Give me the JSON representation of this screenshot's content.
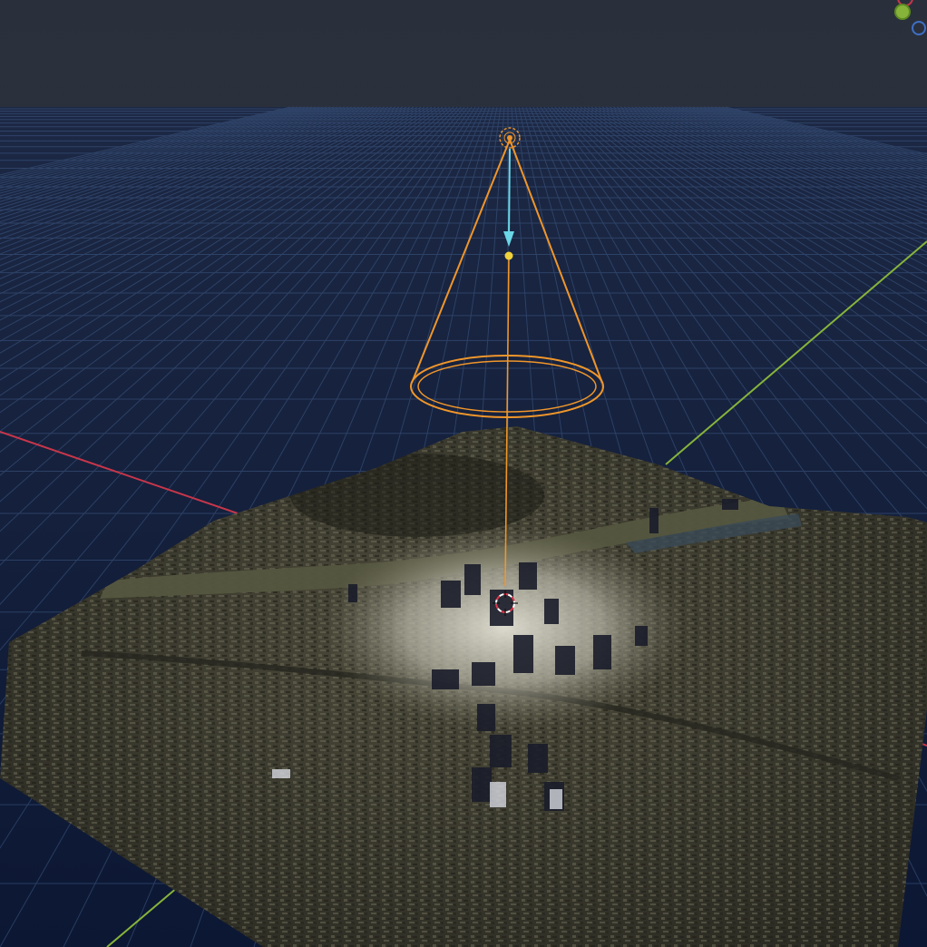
{
  "viewport": {
    "mode": "3d-perspective",
    "scene": "city-terrain",
    "grid": true,
    "colors": {
      "sky_top": "#2a303b",
      "sky_horizon": "#263244",
      "grid_floor": "#0f1a38",
      "grid_line": "#3f5a86",
      "x_axis": "#c8364a",
      "y_axis": "#86b43a",
      "terrain_dark": "#2b2a22",
      "terrain_mid": "#4a4838",
      "river": "#5b5c48",
      "spotlight_pool": "#d8d8cc",
      "light_gizmo": "#f0962a",
      "light_direction": "#6ad6e6",
      "light_target_point": "#f0d23a",
      "cursor_3d": "#e2364a"
    }
  },
  "objects": {
    "spot_light": {
      "type": "spot-light",
      "selected": true
    },
    "cursor_3d": {
      "type": "3d-cursor"
    }
  },
  "navigation_gizmo": {
    "axes": [
      "x-axis",
      "y-axis",
      "z-axis"
    ],
    "colors": {
      "x": "#c8364a",
      "y": "#86b43a",
      "z": "#3e6fc4"
    }
  }
}
